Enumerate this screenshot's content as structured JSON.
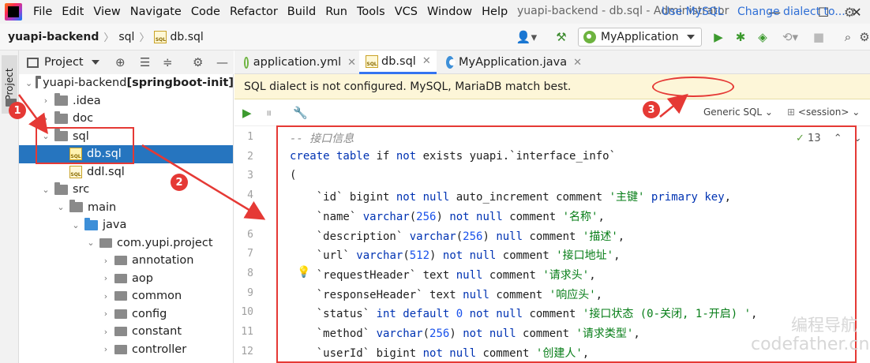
{
  "menubar": {
    "items": [
      "File",
      "Edit",
      "View",
      "Navigate",
      "Code",
      "Refactor",
      "Build",
      "Run",
      "Tools",
      "VCS",
      "Window",
      "Help"
    ],
    "window_title": "yuapi-backend - db.sql - Administrator",
    "controls": {
      "minimize": "—",
      "maximize": "☐",
      "close": "✕"
    }
  },
  "breadcrumb": {
    "project": "yuapi-backend",
    "folder": "sql",
    "file": "db.sql"
  },
  "run_config": {
    "label": "MyApplication"
  },
  "project_panel": {
    "title": "Project",
    "stripe_label": "Project",
    "tree": [
      {
        "label": "yuapi-backend",
        "suffix": "[springboot-init]",
        "type": "root",
        "depth": 0,
        "expanded": true
      },
      {
        "label": ".idea",
        "type": "folder",
        "depth": 1,
        "expanded": false
      },
      {
        "label": "doc",
        "type": "folder",
        "depth": 1,
        "expanded": false
      },
      {
        "label": "sql",
        "type": "folder",
        "depth": 1,
        "expanded": true
      },
      {
        "label": "db.sql",
        "type": "sql",
        "depth": 2,
        "selected": true
      },
      {
        "label": "ddl.sql",
        "type": "sql",
        "depth": 2
      },
      {
        "label": "src",
        "type": "folder",
        "depth": 1,
        "expanded": true
      },
      {
        "label": "main",
        "type": "folder",
        "depth": 2,
        "expanded": true
      },
      {
        "label": "java",
        "type": "java-folder",
        "depth": 3,
        "expanded": true
      },
      {
        "label": "com.yupi.project",
        "type": "package",
        "depth": 4,
        "expanded": true
      },
      {
        "label": "annotation",
        "type": "package",
        "depth": 5,
        "expanded": false
      },
      {
        "label": "aop",
        "type": "package",
        "depth": 5,
        "expanded": false
      },
      {
        "label": "common",
        "type": "package",
        "depth": 5,
        "expanded": false
      },
      {
        "label": "config",
        "type": "package",
        "depth": 5,
        "expanded": false
      },
      {
        "label": "constant",
        "type": "package",
        "depth": 5,
        "expanded": false
      },
      {
        "label": "controller",
        "type": "package",
        "depth": 5,
        "expanded": false
      }
    ]
  },
  "editor": {
    "tabs": [
      {
        "label": "application.yml",
        "icon": "spring-icon"
      },
      {
        "label": "db.sql",
        "icon": "sql-file-icon",
        "active": true
      },
      {
        "label": "MyApplication.java",
        "icon": "java-class-icon"
      }
    ],
    "banner": {
      "message": "SQL dialect is not configured. MySQL, MariaDB match best.",
      "use_mysql": "Use MySQL",
      "change_dialect": "Change dialect to..."
    },
    "toolbar": {
      "dialect": "Generic SQL",
      "session": "<session>"
    },
    "inspection": {
      "count": "13"
    },
    "lines": [
      {
        "n": "1",
        "tokens": [
          [
            "cm",
            "-- 接口信息"
          ]
        ]
      },
      {
        "n": "2",
        "tokens": [
          [
            "kw",
            "create table "
          ],
          [
            "",
            "if "
          ],
          [
            "kw",
            "not "
          ],
          [
            "",
            "exists "
          ],
          [
            "",
            "yuapi.`interface_info`"
          ]
        ]
      },
      {
        "n": "3",
        "tokens": [
          [
            "",
            "("
          ]
        ]
      },
      {
        "n": "4",
        "tokens": [
          [
            "",
            "    `id` "
          ],
          [
            "",
            "bigint "
          ],
          [
            "kw",
            "not null "
          ],
          [
            "",
            "auto_increment "
          ],
          [
            "",
            "comment "
          ],
          [
            "str",
            "'主键' "
          ],
          [
            "kw",
            "primary key"
          ],
          [
            "",
            ","
          ]
        ]
      },
      {
        "n": "5",
        "tokens": [
          [
            "",
            "    `name` "
          ],
          [
            "kw",
            "varchar"
          ],
          [
            "",
            "("
          ],
          [
            "num",
            "256"
          ],
          [
            "",
            ") "
          ],
          [
            "kw",
            "not null "
          ],
          [
            "",
            "comment "
          ],
          [
            "str",
            "'名称'"
          ],
          [
            "",
            ","
          ]
        ]
      },
      {
        "n": "6",
        "tokens": [
          [
            "",
            "    `description` "
          ],
          [
            "kw",
            "varchar"
          ],
          [
            "",
            "("
          ],
          [
            "num",
            "256"
          ],
          [
            "",
            ") "
          ],
          [
            "kw",
            "null "
          ],
          [
            "",
            "comment "
          ],
          [
            "str",
            "'描述'"
          ],
          [
            "",
            ","
          ]
        ]
      },
      {
        "n": "7",
        "tokens": [
          [
            "",
            "    `url` "
          ],
          [
            "kw",
            "varchar"
          ],
          [
            "",
            "("
          ],
          [
            "num",
            "512"
          ],
          [
            "",
            ") "
          ],
          [
            "kw",
            "not null "
          ],
          [
            "",
            "comment "
          ],
          [
            "str",
            "'接口地址'"
          ],
          [
            "",
            ","
          ]
        ]
      },
      {
        "n": "8",
        "tokens": [
          [
            "",
            "    `requestHeader` "
          ],
          [
            "",
            "text "
          ],
          [
            "kw",
            "null "
          ],
          [
            "",
            "comment "
          ],
          [
            "str",
            "'请求头'"
          ],
          [
            "",
            ","
          ]
        ]
      },
      {
        "n": "9",
        "tokens": [
          [
            "",
            "    `responseHeader` "
          ],
          [
            "",
            "text "
          ],
          [
            "kw",
            "null "
          ],
          [
            "",
            "comment "
          ],
          [
            "str",
            "'响应头'"
          ],
          [
            "",
            ","
          ]
        ]
      },
      {
        "n": "10",
        "tokens": [
          [
            "",
            "    `status` "
          ],
          [
            "kw",
            "int "
          ],
          [
            "kw",
            "default "
          ],
          [
            "num",
            "0 "
          ],
          [
            "kw",
            "not null "
          ],
          [
            "",
            "comment "
          ],
          [
            "str",
            "'接口状态 (0-关闭, 1-开启) '"
          ],
          [
            "",
            ","
          ]
        ]
      },
      {
        "n": "11",
        "tokens": [
          [
            "",
            "    `method` "
          ],
          [
            "kw",
            "varchar"
          ],
          [
            "",
            "("
          ],
          [
            "num",
            "256"
          ],
          [
            "",
            ") "
          ],
          [
            "kw",
            "not null "
          ],
          [
            "",
            "comment "
          ],
          [
            "str",
            "'请求类型'"
          ],
          [
            "",
            ","
          ]
        ]
      },
      {
        "n": "12",
        "tokens": [
          [
            "",
            "    `userId` "
          ],
          [
            "",
            "bigint "
          ],
          [
            "kw",
            "not null "
          ],
          [
            "",
            "comment "
          ],
          [
            "str",
            "'创建人'"
          ],
          [
            "",
            ","
          ]
        ]
      }
    ]
  },
  "annotations": {
    "step1": "1",
    "step2": "2",
    "step3": "3",
    "color": "#e53935"
  },
  "watermark": {
    "line1": "编程导航",
    "line2": "codefather.cn"
  }
}
